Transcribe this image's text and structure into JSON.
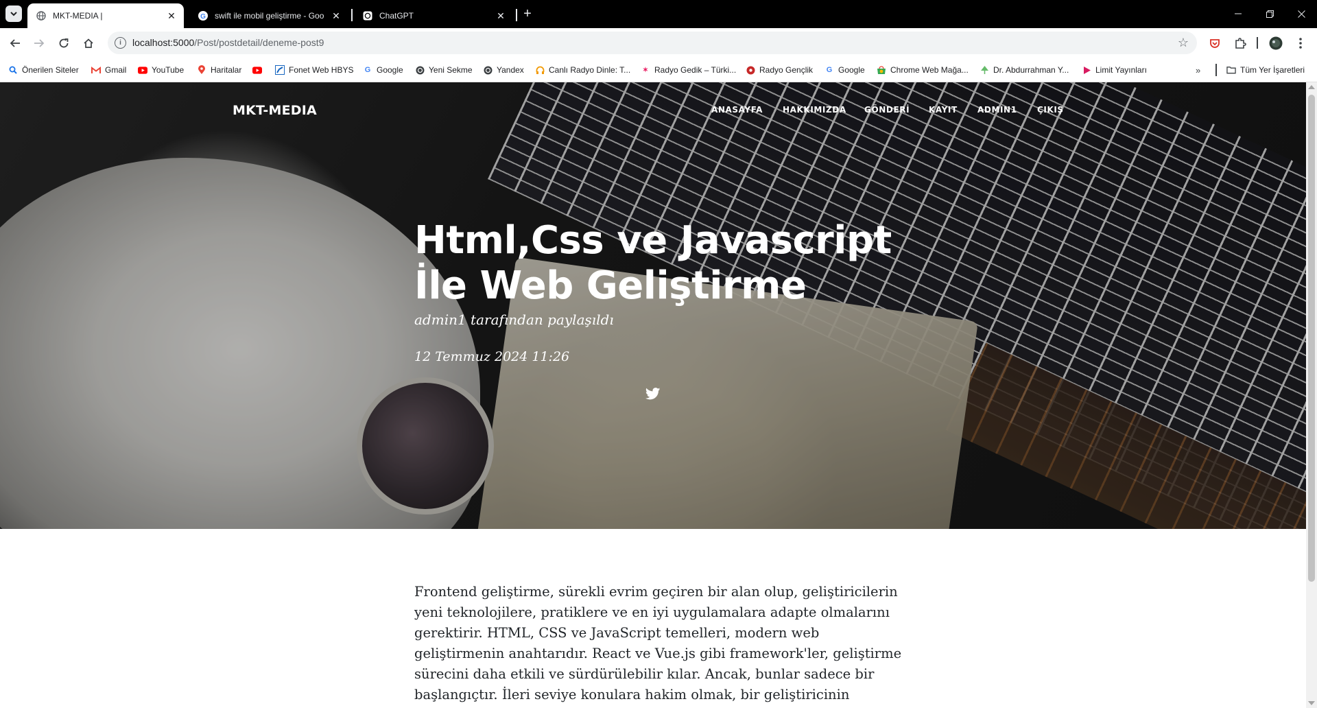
{
  "browser": {
    "tabs": [
      {
        "title": "MKT-MEDIA |",
        "active": true,
        "favicon": "globe-icon"
      },
      {
        "title": "swift ile mobil geliştirme - Goo",
        "active": false,
        "favicon": "google-icon"
      },
      {
        "title": "ChatGPT",
        "active": false,
        "favicon": "chatgpt-icon"
      }
    ],
    "url_host": "localhost:5000",
    "url_path": "/Post/postdetail/deneme-post9",
    "bookmarks": [
      {
        "label": "Önerilen Siteler",
        "icon": "search-icon",
        "color": "#1a73e8"
      },
      {
        "label": "Gmail",
        "icon": "gmail-icon",
        "color": "#ea4335"
      },
      {
        "label": "YouTube",
        "icon": "youtube-icon",
        "color": "#ff0000"
      },
      {
        "label": "Haritalar",
        "icon": "maps-icon",
        "color": "#34a853"
      },
      {
        "label": "",
        "icon": "youtube-icon",
        "color": "#ff0000"
      },
      {
        "label": "Fonet Web HBYS",
        "icon": "fonet-icon",
        "color": "#1565c0"
      },
      {
        "label": "Google",
        "icon": "google-icon",
        "color": "#4285f4"
      },
      {
        "label": "Yeni Sekme",
        "icon": "globe-icon",
        "color": "#5f6368"
      },
      {
        "label": "Yandex",
        "icon": "globe-icon",
        "color": "#5f6368"
      },
      {
        "label": "Canlı Radyo Dinle: T...",
        "icon": "headphones-icon",
        "color": "#f29900"
      },
      {
        "label": "Radyo Gedik – Türki...",
        "icon": "radio-icon",
        "color": "#e91e63"
      },
      {
        "label": "Radyo Gençlik",
        "icon": "radio-icon",
        "color": "#c62828"
      },
      {
        "label": "Google",
        "icon": "google-icon",
        "color": "#4285f4"
      },
      {
        "label": "Chrome Web Mağa...",
        "icon": "chrome-store-icon",
        "color": "#34a853"
      },
      {
        "label": "Dr. Abdurrahman Y...",
        "icon": "tree-icon",
        "color": "#66bb6a"
      },
      {
        "label": "Limit Yayınları",
        "icon": "play-icon",
        "color": "#d81b60"
      }
    ],
    "all_bookmarks_label": "Tüm Yer İşaretleri"
  },
  "site": {
    "brand": "MKT-MEDIA",
    "menu": [
      "ANASAYFA",
      "HAKKIMIZDA",
      "GÖNDERİ",
      "KAYIT",
      "ADMIN1",
      "ÇIKIŞ"
    ]
  },
  "post": {
    "title_line1": "Html,Css ve Javascript",
    "title_line2": "İle Web Geliştirme",
    "author_meta": "admin1 tarafından paylaşıldı",
    "date": "12 Temmuz 2024 11:26",
    "body": "Frontend geliştirme, sürekli evrim geçiren bir alan olup, geliştiricilerin yeni teknolojilere, pratiklere ve en iyi uygulamalara adapte olmalarını gerektirir. HTML, CSS ve JavaScript temelleri, modern web geliştirmenin anahtarıdır. React ve Vue.js gibi framework'ler, geliştirme sürecini daha etkili ve sürdürülebilir kılar. Ancak, bunlar sadece bir başlangıçtır. İleri seviye konulara hakim olmak, bir geliştiricinin yeteneklerini zirveye taşır."
  }
}
